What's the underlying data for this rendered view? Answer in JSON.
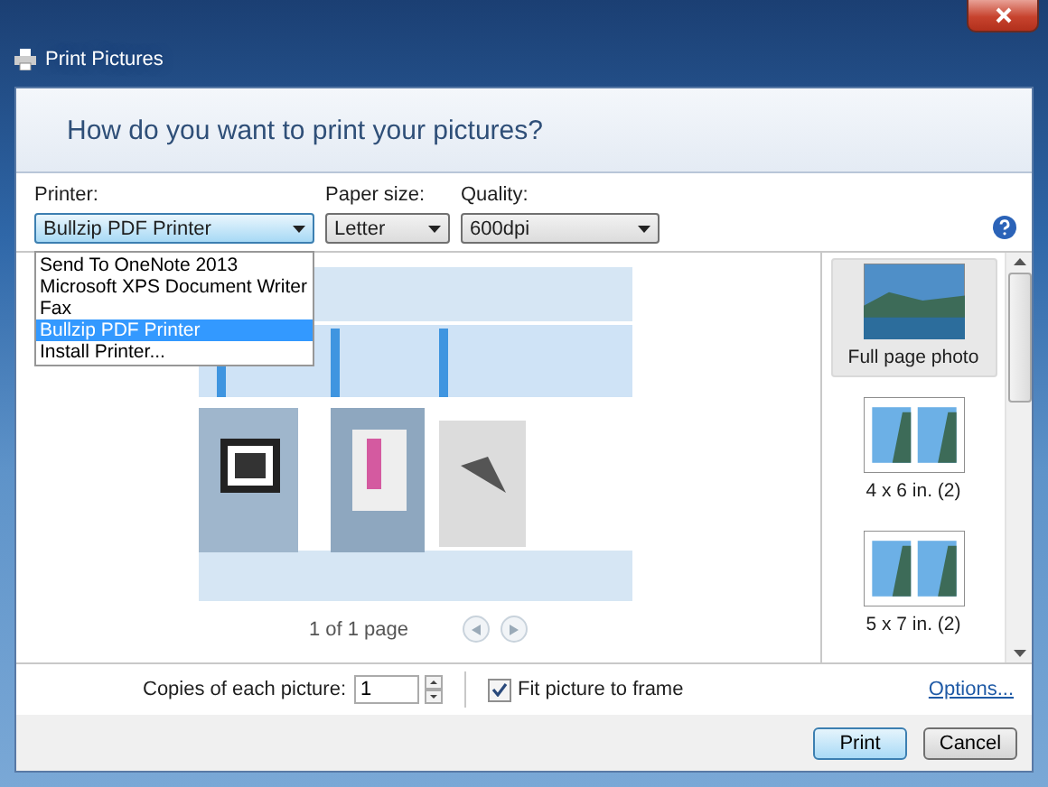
{
  "window": {
    "title": "Print Pictures"
  },
  "header": {
    "question": "How do you want to print your pictures?"
  },
  "printer": {
    "label": "Printer:",
    "value": "Bullzip PDF Printer",
    "expanded": true,
    "options": [
      {
        "label": "Send To OneNote 2013",
        "selected": false
      },
      {
        "label": "Microsoft XPS Document Writer",
        "selected": false
      },
      {
        "label": "Fax",
        "selected": false
      },
      {
        "label": "Bullzip PDF Printer",
        "selected": true
      },
      {
        "label": "Install Printer...",
        "selected": false
      }
    ]
  },
  "paper_size": {
    "label": "Paper size:",
    "value": "Letter"
  },
  "quality": {
    "label": "Quality:",
    "value": "600dpi"
  },
  "preview": {
    "page_label": "1 of 1 page"
  },
  "layouts": [
    {
      "label": "Full page photo",
      "kind": "full",
      "selected": true
    },
    {
      "label": "4 x 6 in. (2)",
      "kind": "double",
      "selected": false
    },
    {
      "label": "5 x 7 in. (2)",
      "kind": "double",
      "selected": false
    }
  ],
  "copies": {
    "label": "Copies of each picture:",
    "value": "1"
  },
  "fit": {
    "label": "Fit picture to frame",
    "checked": true
  },
  "options_link": "Options...",
  "buttons": [
    {
      "label": "Print",
      "default": true
    },
    {
      "label": "Cancel",
      "default": false
    }
  ]
}
